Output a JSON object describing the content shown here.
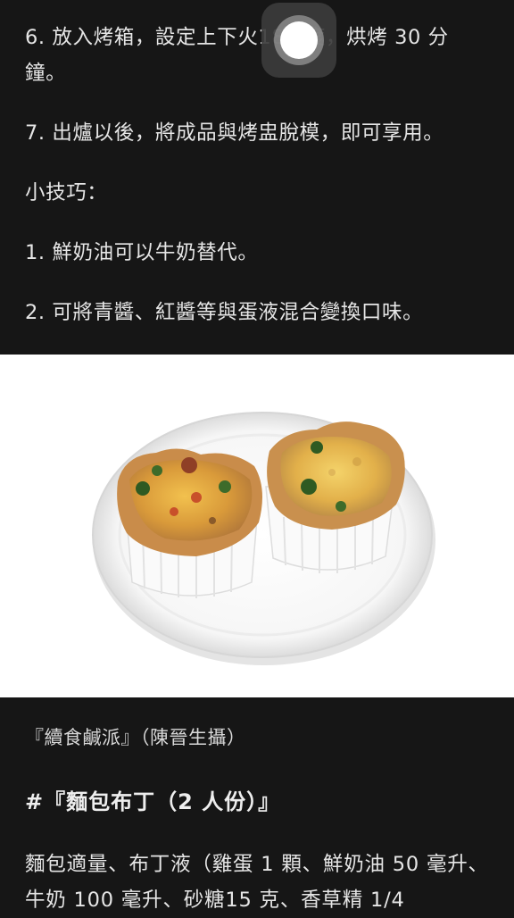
{
  "article": {
    "step6": "6. 放入烤箱，設定上下火180 度，烘烤 30 分鐘。",
    "step7": "7. 出爐以後，將成品與烤盅脫模，即可享用。",
    "tips_title": "小技巧：",
    "tip1": "1. 鮮奶油可以牛奶替代。",
    "tip2": "2. 可將青醬、紅醬等與蛋液混合變換口味。",
    "photo_caption": "『續食鹹派』（陳晉生攝）",
    "section_heading": "#『麵包布丁（2 人份）』",
    "ingredients": "麵包適量、布丁液（雞蛋 1 顆、鮮奶油 50 毫升、牛奶 100 毫升、砂糖15 克、香草精 1/4"
  },
  "overlay": {
    "assistive_touch": "assistive-touch-button"
  },
  "colors": {
    "background": "#161616",
    "text": "#e6e6e6",
    "photo_bg": "#ffffff"
  }
}
